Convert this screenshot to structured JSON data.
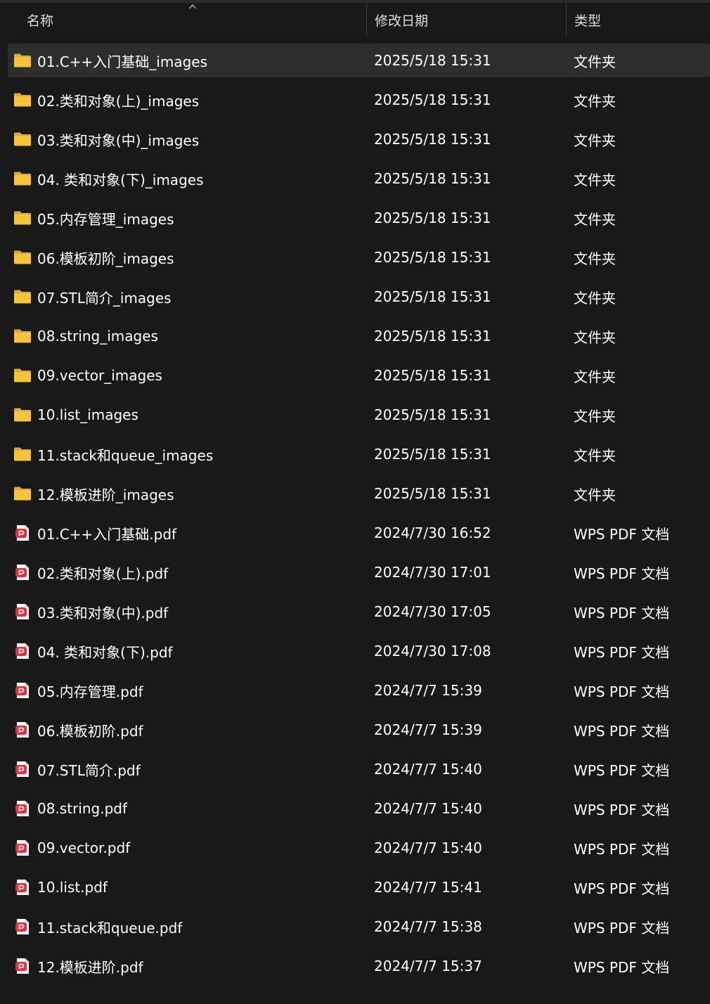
{
  "columns": {
    "name": "名称",
    "date": "修改日期",
    "type": "类型"
  },
  "sort": {
    "column": "name",
    "direction": "ascending",
    "icon": "sort-up-icon"
  },
  "colors": {
    "background": "#191919",
    "selected_row": "#2e2e2e",
    "folder_icon": "#f8c33c",
    "pdf_icon": "#e0323d"
  },
  "files": [
    {
      "name": "01.C++入门基础_images",
      "date": "2025/5/18 15:31",
      "type": "文件夹",
      "icon": "folder-icon",
      "selected": true
    },
    {
      "name": "02.类和对象(上)_images",
      "date": "2025/5/18 15:31",
      "type": "文件夹",
      "icon": "folder-icon"
    },
    {
      "name": "03.类和对象(中)_images",
      "date": "2025/5/18 15:31",
      "type": "文件夹",
      "icon": "folder-icon"
    },
    {
      "name": "04. 类和对象(下)_images",
      "date": "2025/5/18 15:31",
      "type": "文件夹",
      "icon": "folder-icon"
    },
    {
      "name": "05.内存管理_images",
      "date": "2025/5/18 15:31",
      "type": "文件夹",
      "icon": "folder-icon"
    },
    {
      "name": "06.模板初阶_images",
      "date": "2025/5/18 15:31",
      "type": "文件夹",
      "icon": "folder-icon"
    },
    {
      "name": "07.STL简介_images",
      "date": "2025/5/18 15:31",
      "type": "文件夹",
      "icon": "folder-icon"
    },
    {
      "name": "08.string_images",
      "date": "2025/5/18 15:31",
      "type": "文件夹",
      "icon": "folder-icon"
    },
    {
      "name": "09.vector_images",
      "date": "2025/5/18 15:31",
      "type": "文件夹",
      "icon": "folder-icon"
    },
    {
      "name": "10.list_images",
      "date": "2025/5/18 15:31",
      "type": "文件夹",
      "icon": "folder-icon"
    },
    {
      "name": "11.stack和queue_images",
      "date": "2025/5/18 15:31",
      "type": "文件夹",
      "icon": "folder-icon"
    },
    {
      "name": "12.模板进阶_images",
      "date": "2025/5/18 15:31",
      "type": "文件夹",
      "icon": "folder-icon"
    },
    {
      "name": "01.C++入门基础.pdf",
      "date": "2024/7/30 16:52",
      "type": "WPS PDF 文档",
      "icon": "pdf-icon"
    },
    {
      "name": "02.类和对象(上).pdf",
      "date": "2024/7/30 17:01",
      "type": "WPS PDF 文档",
      "icon": "pdf-icon"
    },
    {
      "name": "03.类和对象(中).pdf",
      "date": "2024/7/30 17:05",
      "type": "WPS PDF 文档",
      "icon": "pdf-icon"
    },
    {
      "name": "04. 类和对象(下).pdf",
      "date": "2024/7/30 17:08",
      "type": "WPS PDF 文档",
      "icon": "pdf-icon"
    },
    {
      "name": "05.内存管理.pdf",
      "date": "2024/7/7 15:39",
      "type": "WPS PDF 文档",
      "icon": "pdf-icon"
    },
    {
      "name": "06.模板初阶.pdf",
      "date": "2024/7/7 15:39",
      "type": "WPS PDF 文档",
      "icon": "pdf-icon"
    },
    {
      "name": "07.STL简介.pdf",
      "date": "2024/7/7 15:40",
      "type": "WPS PDF 文档",
      "icon": "pdf-icon"
    },
    {
      "name": "08.string.pdf",
      "date": "2024/7/7 15:40",
      "type": "WPS PDF 文档",
      "icon": "pdf-icon"
    },
    {
      "name": "09.vector.pdf",
      "date": "2024/7/7 15:40",
      "type": "WPS PDF 文档",
      "icon": "pdf-icon"
    },
    {
      "name": "10.list.pdf",
      "date": "2024/7/7 15:41",
      "type": "WPS PDF 文档",
      "icon": "pdf-icon"
    },
    {
      "name": "11.stack和queue.pdf",
      "date": "2024/7/7 15:38",
      "type": "WPS PDF 文档",
      "icon": "pdf-icon"
    },
    {
      "name": "12.模板进阶.pdf",
      "date": "2024/7/7 15:37",
      "type": "WPS PDF 文档",
      "icon": "pdf-icon"
    }
  ]
}
